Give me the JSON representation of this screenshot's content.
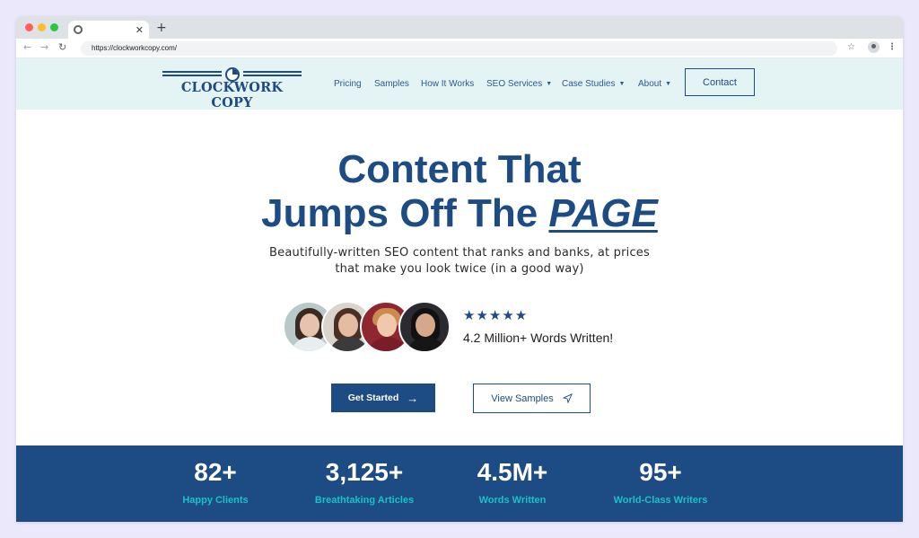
{
  "browser": {
    "tab_title": "",
    "url": "https://clockworkcopy.com/",
    "colors": {
      "close": "#ff5f57",
      "minimize": "#febc2e",
      "maximize": "#28c840"
    }
  },
  "site": {
    "logo_text": "CLOCKWORK COPY",
    "nav": [
      {
        "label": "Pricing",
        "dropdown": false
      },
      {
        "label": "Samples",
        "dropdown": false
      },
      {
        "label": "How It Works",
        "dropdown": false
      },
      {
        "label": "SEO Services",
        "dropdown": true
      },
      {
        "label": "Case Studies",
        "dropdown": true
      },
      {
        "label": "About",
        "dropdown": true
      }
    ],
    "contact_label": "Contact"
  },
  "hero": {
    "title_line1": "Content That",
    "title_line2_prefix": "Jumps Off The ",
    "title_line2_emphasis": "PAGE",
    "subtitle_line1": "Beautifully-written SEO content that ranks and banks, at prices",
    "subtitle_line2": "that make you look twice (in a good way)",
    "rating_stars": "★★★★★",
    "rating": 5,
    "words_written": "4.2 Million+ Words Written!",
    "cta_primary": "Get Started",
    "cta_secondary": "View Samples"
  },
  "stats": [
    {
      "value": "82+",
      "label": "Happy Clients"
    },
    {
      "value": "3,125+",
      "label": "Breathtaking Articles"
    },
    {
      "value": "4.5M+",
      "label": "Words Written"
    },
    {
      "value": "95+",
      "label": "World-Class Writers"
    }
  ],
  "colors": {
    "brand": "#1d4b83",
    "header_bg": "#e4f3f3",
    "stat_label": "#18c2c9",
    "page_bg": "#ebe8fb"
  }
}
